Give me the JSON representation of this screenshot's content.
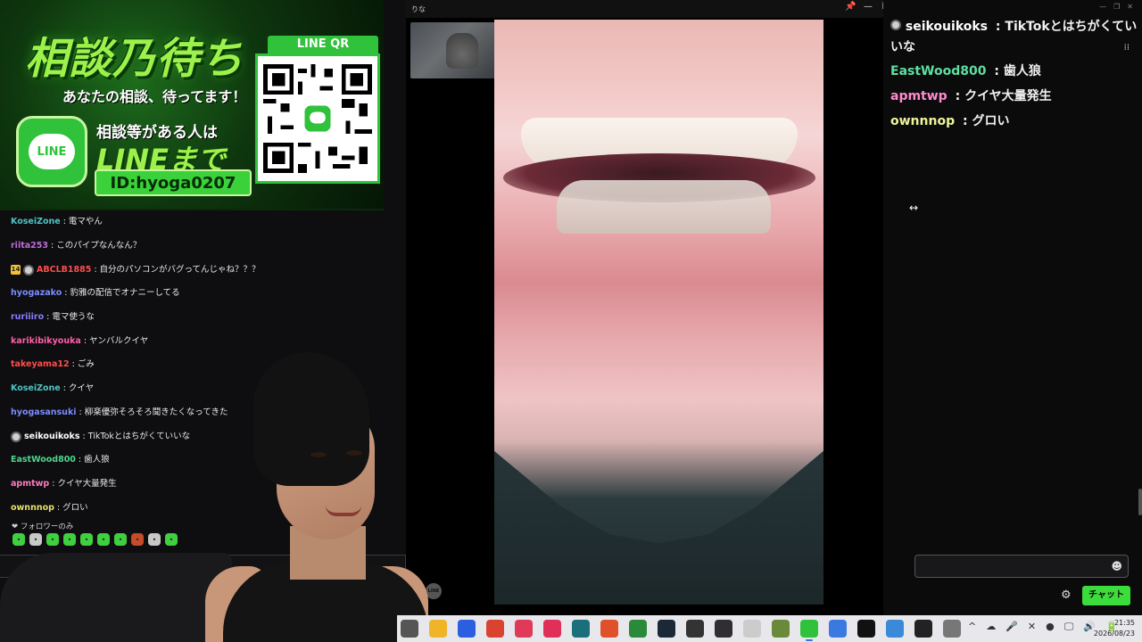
{
  "banner": {
    "title": "相談乃待ち",
    "subtitle": "あなたの相談、待ってます！",
    "line_logo_text": "LINE",
    "line1": "相談等がある人は",
    "line2": "LINEまで",
    "id_text": "ID:hyoga0207",
    "qr_label": "LINE QR"
  },
  "left_chat": {
    "messages": [
      {
        "user": "KoseiZone",
        "text": "電マやん",
        "color": "#4fc3c3"
      },
      {
        "user": "riita253",
        "text": "このパイプなんなん？",
        "color": "#c06bd8"
      },
      {
        "user": "ABCLB1885",
        "text": "自分のパソコンがバグってんじゃね？？？",
        "color": "#ff4d4d",
        "badge": "14",
        "avatar": true
      },
      {
        "user": "hyogazako",
        "text": "豹雅の配信でオナニーしてる",
        "color": "#7b8cff"
      },
      {
        "user": "ruriiiro",
        "text": "電マ使うな",
        "color": "#8b7bff"
      },
      {
        "user": "karikibikyouka",
        "text": "ヤンバルクイヤ",
        "color": "#ff5ea8"
      },
      {
        "user": "takeyama12",
        "text": "ごみ",
        "color": "#ff4d4d"
      },
      {
        "user": "KoseiZone",
        "text": "クイヤ",
        "color": "#4fc3c3"
      },
      {
        "user": "hyogasansuki",
        "text": "柳楽優弥そろそろ聞きたくなってきた",
        "color": "#7b8cff"
      },
      {
        "user": "seikouikoks",
        "text": "TikTokとはちがくていいな",
        "color": "#ffffff",
        "avatar": true
      },
      {
        "user": "EastWood800",
        "text": "歯人狼",
        "color": "#4fd48c"
      },
      {
        "user": "apmtwp",
        "text": "クイヤ大量発生",
        "color": "#ff7ac0"
      },
      {
        "user": "ownnnop",
        "text": "グロい",
        "color": "#e3e06a"
      }
    ],
    "follower_note": "❤ フォロワーのみ"
  },
  "call": {
    "title": "りな",
    "pin": "📌",
    "minimize": "—",
    "maximize": "☐",
    "close": "✕",
    "watermark": "LINE"
  },
  "right_chat": {
    "messages": [
      {
        "user": "seikouikoks",
        "sep": " : ",
        "text": "TikTokとはちがくてい",
        "text2": "いな",
        "color": "#ffffff"
      },
      {
        "user": "EastWood800",
        "sep": " : ",
        "text": "歯人狼",
        "color": "#5de0a0"
      },
      {
        "user": "apmtwp",
        "sep": " : ",
        "text": "クイヤ大量発生",
        "color": "#ff8ad0"
      },
      {
        "user": "ownnnop",
        "sep": " : ",
        "text": "グロい",
        "color": "#eef59a"
      }
    ],
    "top_icons": [
      "—",
      "❐",
      "✕"
    ],
    "side_icon": "⁞⁞",
    "emoji_icon": "☻",
    "settings_icon": "⚙",
    "chat_button": "チャット"
  },
  "resize_cursor": "↔",
  "taskbar": {
    "apps": [
      {
        "name": "task-view-icon",
        "color": "#555"
      },
      {
        "name": "file-explorer-icon",
        "color": "#f0b429"
      },
      {
        "name": "app-blue-icon",
        "color": "#2b5fe0"
      },
      {
        "name": "chrome-icon",
        "color": "#d9432f"
      },
      {
        "name": "app-pink-icon",
        "color": "#e03a5a"
      },
      {
        "name": "tiktok-icon",
        "color": "#e0305a"
      },
      {
        "name": "app-teal-icon",
        "color": "#1b6f7a"
      },
      {
        "name": "brave-icon",
        "color": "#e0502a"
      },
      {
        "name": "app-green-icon",
        "color": "#2a8a3a"
      },
      {
        "name": "steam-icon",
        "color": "#1b2838"
      },
      {
        "name": "davinci-icon",
        "color": "#333"
      },
      {
        "name": "obs-icon",
        "color": "#302e31"
      },
      {
        "name": "app-white-icon",
        "color": "#ccc"
      },
      {
        "name": "minecraft-icon",
        "color": "#6a8a3a"
      },
      {
        "name": "line-icon",
        "color": "#2fc23a",
        "active": true
      },
      {
        "name": "app-notify-icon",
        "color": "#3a7ae0"
      },
      {
        "name": "unreal-icon",
        "color": "#111"
      },
      {
        "name": "photos-icon",
        "color": "#3a8ad8"
      },
      {
        "name": "app-black-icon",
        "color": "#222"
      },
      {
        "name": "settings-icon",
        "color": "#777"
      }
    ],
    "tray": [
      "^",
      "☁",
      "🎤",
      "✕",
      "●",
      "🖵",
      "🔊",
      "🔋"
    ],
    "time": "21:35",
    "date": "2026/08/23"
  }
}
